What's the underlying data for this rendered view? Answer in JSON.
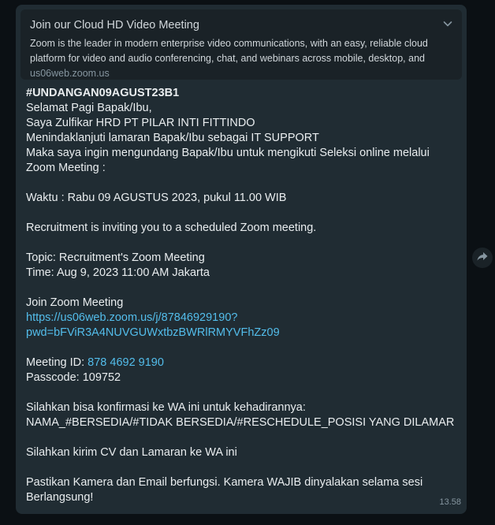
{
  "link_preview": {
    "title": "Join our Cloud HD Video Meeting",
    "description_lines": [
      "Zoom is the leader in modern enterprise video communications, with an easy, reliable cloud",
      "platform for video and audio conferencing, chat, and webinars across mobile, desktop, and"
    ],
    "domain": "us06web.zoom.us",
    "expand_icon": "chevron-down-icon"
  },
  "message": {
    "heading": "#UNDANGAN09AGUST23B1",
    "greeting": "Selamat Pagi Bapak/Ibu,",
    "intro1": "Saya Zulfikar HRD PT PILAR INTI FITTINDO",
    "intro2": "Menindaklanjuti lamaran Bapak/Ibu sebagai IT SUPPORT",
    "intro3": "Maka saya ingin mengundang Bapak/Ibu untuk mengikuti Seleksi online melalui",
    "intro4": "Zoom Meeting :",
    "waktu": "Waktu : Rabu 09 AGUSTUS 2023, pukul 11.00 WIB",
    "invite": "Recruitment is inviting you to a scheduled Zoom meeting.",
    "topic": "Topic: Recruitment's Zoom Meeting",
    "time": "Time: Aug 9, 2023 11:00 AM Jakarta",
    "join_label": "Join Zoom Meeting",
    "join_link_line1": "https://us06web.zoom.us/j/87846929190?",
    "join_link_line2": "pwd=bFViR3A4NUVGUWxtbzBWRlRMYVFhZz09",
    "meeting_id_label": "Meeting ID: ",
    "meeting_id_value": "878 4692 9190",
    "passcode": "Passcode: 109752",
    "confirm1": "Silahkan bisa konfirmasi ke WA ini untuk kehadirannya:",
    "confirm2": "NAMA_#BERSEDIA/#TIDAK BERSEDIA/#RESCHEDULE_POSISI YANG DILAMAR",
    "send_cv": "Silahkan kirim CV dan Lamaran ke WA ini",
    "camera1": "Pastikan Kamera dan Email berfungsi.  Kamera WAJIB dinyalakan selama sesi",
    "camera2": "Berlangsung!",
    "timestamp": "13.58"
  },
  "forward_icon": "forward-arrow-icon",
  "colors": {
    "background": "#0b1014",
    "bubble": "#202c33",
    "preview": "#1a2227",
    "text": "#e9edef",
    "link": "#53bdeb",
    "muted": "#8696a0"
  }
}
